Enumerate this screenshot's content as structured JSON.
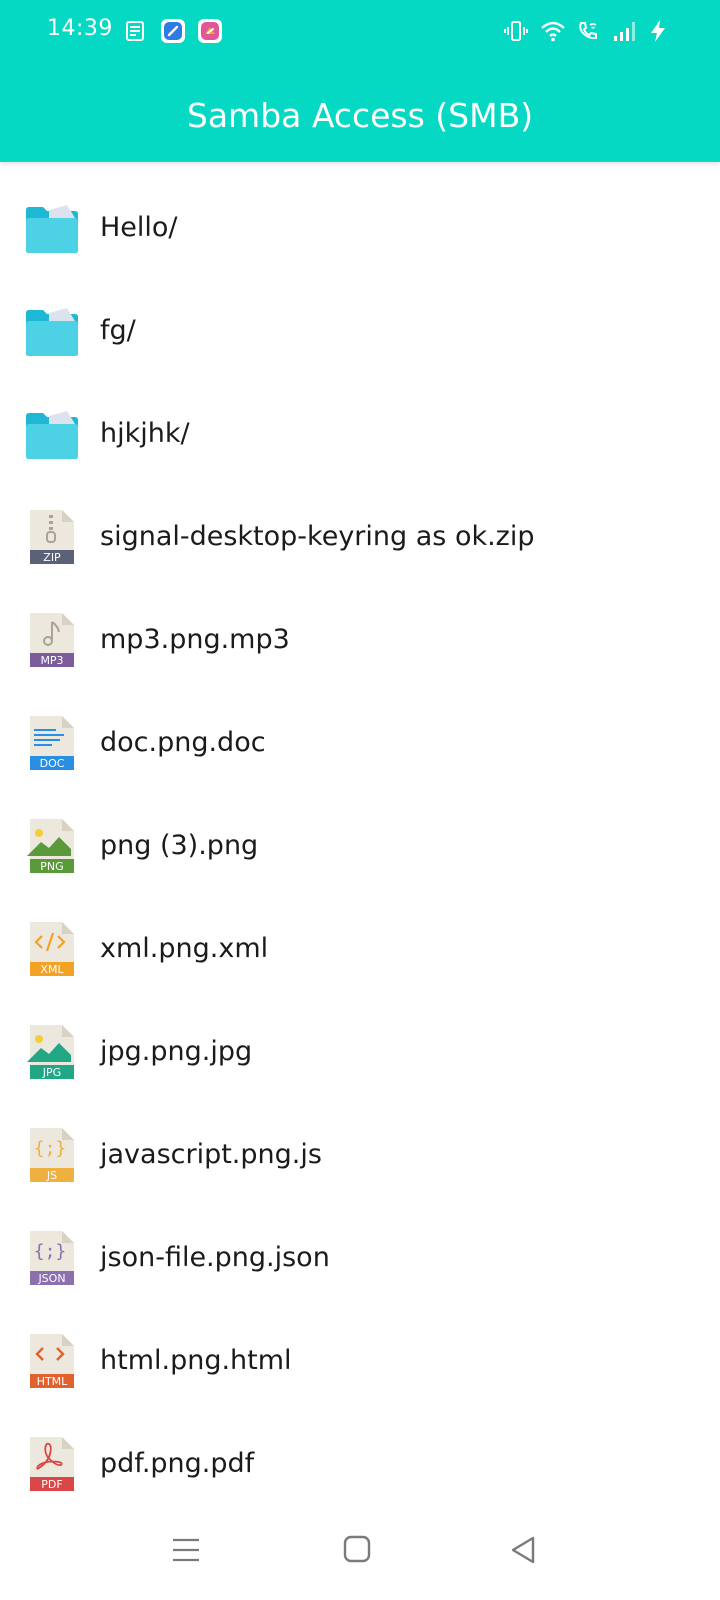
{
  "status_bar": {
    "time": "14:39"
  },
  "app_bar": {
    "title": "Samba Access (SMB)",
    "color": "#05d9c4"
  },
  "files": [
    {
      "name": "Hello/",
      "kind": "folder",
      "icon": "folder-icon"
    },
    {
      "name": "fg/",
      "kind": "folder",
      "icon": "folder-icon"
    },
    {
      "name": "hjkjhk/",
      "kind": "folder",
      "icon": "folder-icon"
    },
    {
      "name": "signal-desktop-keyring as ok.zip",
      "kind": "file",
      "icon": "zip-file-icon",
      "badge": "ZIP",
      "badge_color": "#5b6177",
      "glyph": "zip"
    },
    {
      "name": "mp3.png.mp3",
      "kind": "file",
      "icon": "mp3-file-icon",
      "badge": "MP3",
      "badge_color": "#7c5c9c",
      "glyph": "note"
    },
    {
      "name": "doc.png.doc",
      "kind": "file",
      "icon": "doc-file-icon",
      "badge": "DOC",
      "badge_color": "#2a8ee3",
      "glyph": "lines"
    },
    {
      "name": "png (3).png",
      "kind": "file",
      "icon": "png-file-icon",
      "badge": "PNG",
      "badge_color": "#5b9a3a",
      "glyph": "image"
    },
    {
      "name": "xml.png.xml",
      "kind": "file",
      "icon": "xml-file-icon",
      "badge": "XML",
      "badge_color": "#f2a225",
      "glyph": "code-slash"
    },
    {
      "name": "jpg.png.jpg",
      "kind": "file",
      "icon": "jpg-file-icon",
      "badge": "JPG",
      "badge_color": "#21a686",
      "glyph": "image"
    },
    {
      "name": "javascript.png.js",
      "kind": "file",
      "icon": "js-file-icon",
      "badge": "JS",
      "badge_color": "#eeb03f",
      "glyph": "braces"
    },
    {
      "name": "json-file.png.json",
      "kind": "file",
      "icon": "json-file-icon",
      "badge": "JSON",
      "badge_color": "#8b6fae",
      "glyph": "braces"
    },
    {
      "name": "html.png.html",
      "kind": "file",
      "icon": "html-file-icon",
      "badge": "HTML",
      "badge_color": "#e1622f",
      "glyph": "angle"
    },
    {
      "name": "pdf.png.pdf",
      "kind": "file",
      "icon": "pdf-file-icon",
      "badge": "PDF",
      "badge_color": "#d94646",
      "glyph": "acrobat"
    }
  ]
}
